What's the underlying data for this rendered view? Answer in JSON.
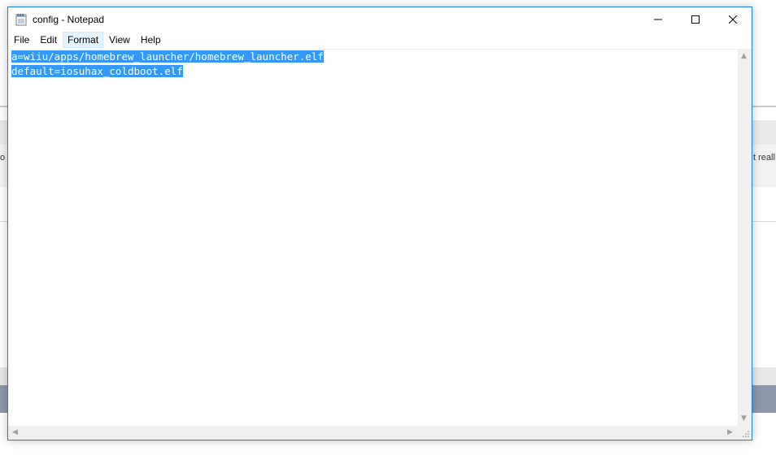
{
  "window": {
    "title": "config - Notepad",
    "accent": "#1883d7"
  },
  "menu": {
    "file": "File",
    "edit": "Edit",
    "format": "Format",
    "view": "View",
    "help": "Help"
  },
  "editor": {
    "lines": [
      "a=wiiu/apps/homebrew_launcher/homebrew_launcher.elf",
      "default=iosuhax_coldboot.elf"
    ],
    "selection_color": "#3399ff"
  },
  "background": {
    "left_fragment": "o",
    "right_fragment": "t reall"
  }
}
